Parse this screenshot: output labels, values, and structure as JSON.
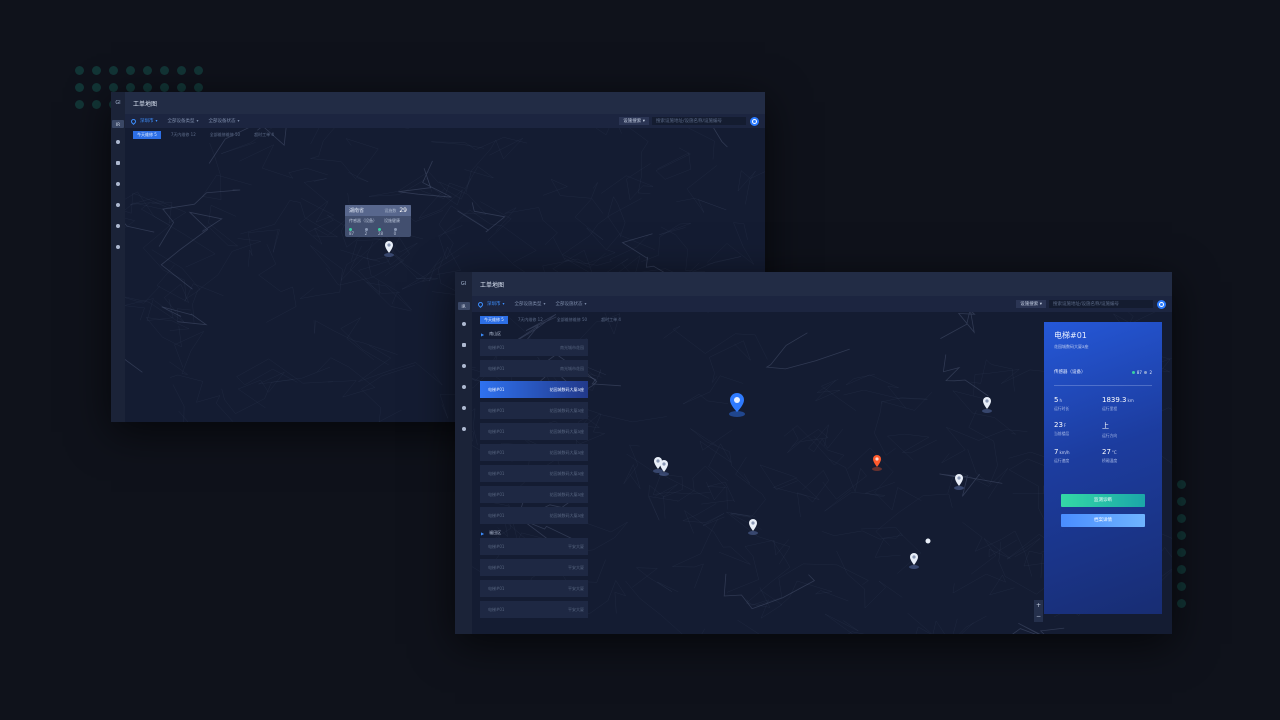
{
  "back_window": {
    "logo": "GI",
    "title": "工单地图",
    "sidebar_active": "IR",
    "city_dropdown": "深圳市",
    "device_type_dropdown": "全部设备类型",
    "device_status_dropdown": "全部设备状态",
    "search_type": "设施搜索",
    "search_placeholder": "搜索设施地址/设施名称/设施编号",
    "filters": [
      {
        "label": "今天维修 5",
        "active": true
      },
      {
        "label": "7天内维修 12",
        "active": false
      },
      {
        "label": "全部维修维修 50",
        "active": false
      },
      {
        "label": "超时工单 4",
        "active": false
      }
    ],
    "tooltip": {
      "province": "湖南省",
      "label": "设施数",
      "count": "29",
      "left_label": "传感器（设备）",
      "right_label": "设施健康",
      "stats": [
        "87",
        "2",
        "28",
        "0"
      ]
    }
  },
  "front_window": {
    "logo": "GI",
    "title": "工单地图",
    "sidebar_active": "IR",
    "city_dropdown": "深圳市",
    "device_type_dropdown": "全部设施类型",
    "device_status_dropdown": "全部设施状态",
    "search_type": "设施搜索",
    "search_placeholder": "搜索设施地址/设施名称/设施编号",
    "filters": [
      {
        "label": "今天维修 5",
        "active": true
      },
      {
        "label": "7天内维修 12",
        "active": false
      },
      {
        "label": "全部维修维修 50",
        "active": false
      },
      {
        "label": "超时工单 4",
        "active": false
      }
    ],
    "districts": [
      {
        "name": "南山区",
        "items": [
          {
            "name": "电梯#01",
            "location": "南光城市花园",
            "active": false
          },
          {
            "name": "电梯#01",
            "location": "南光城市花园",
            "active": false
          },
          {
            "name": "电梯#01",
            "location": "花园城数码大厦a座",
            "active": true
          },
          {
            "name": "电梯#01",
            "location": "花园城数码大厦a座",
            "active": false
          },
          {
            "name": "电梯#01",
            "location": "花园城数码大厦a座",
            "active": false
          },
          {
            "name": "电梯#01",
            "location": "花园城数码大厦a座",
            "active": false
          },
          {
            "name": "电梯#01",
            "location": "花园城数码大厦a座",
            "active": false
          },
          {
            "name": "电梯#01",
            "location": "花园城数码大厦a座",
            "active": false
          },
          {
            "name": "电梯#01",
            "location": "花园城数码大厦a座",
            "active": false
          }
        ]
      },
      {
        "name": "福田区",
        "items": [
          {
            "name": "电梯#01",
            "location": "平安大厦",
            "active": false
          },
          {
            "name": "电梯#01",
            "location": "平安大厦",
            "active": false
          },
          {
            "name": "电梯#01",
            "location": "平安大厦",
            "active": false
          },
          {
            "name": "电梯#01",
            "location": "平安大厦",
            "active": false
          }
        ]
      }
    ],
    "detail": {
      "name": "电梯#01",
      "address": "花园城数码大厦a座",
      "sensor_label": "传感器（设备）",
      "sensor_ok": "87",
      "sensor_bad": "2",
      "metrics": [
        {
          "value": "5",
          "unit": "h",
          "label": "运行时长"
        },
        {
          "value": "1839.3",
          "unit": "km",
          "label": "运行里程"
        },
        {
          "value": "23",
          "unit": "F",
          "label": "当前楼层"
        },
        {
          "value": "上",
          "unit": "",
          "label": "运行方向"
        },
        {
          "value": "7",
          "unit": "km/h",
          "label": "运行速度"
        },
        {
          "value": "27",
          "unit": "°C",
          "label": "桥厢温度"
        }
      ],
      "btn_diagnose": "监测诊断",
      "btn_archive": "档案详情"
    },
    "zoom_in": "+",
    "zoom_out": "−",
    "colors": {
      "accent": "#2f7bff",
      "alert": "#ff5a2c",
      "ok": "#3ad0a0",
      "panel": "#2558d8"
    }
  }
}
